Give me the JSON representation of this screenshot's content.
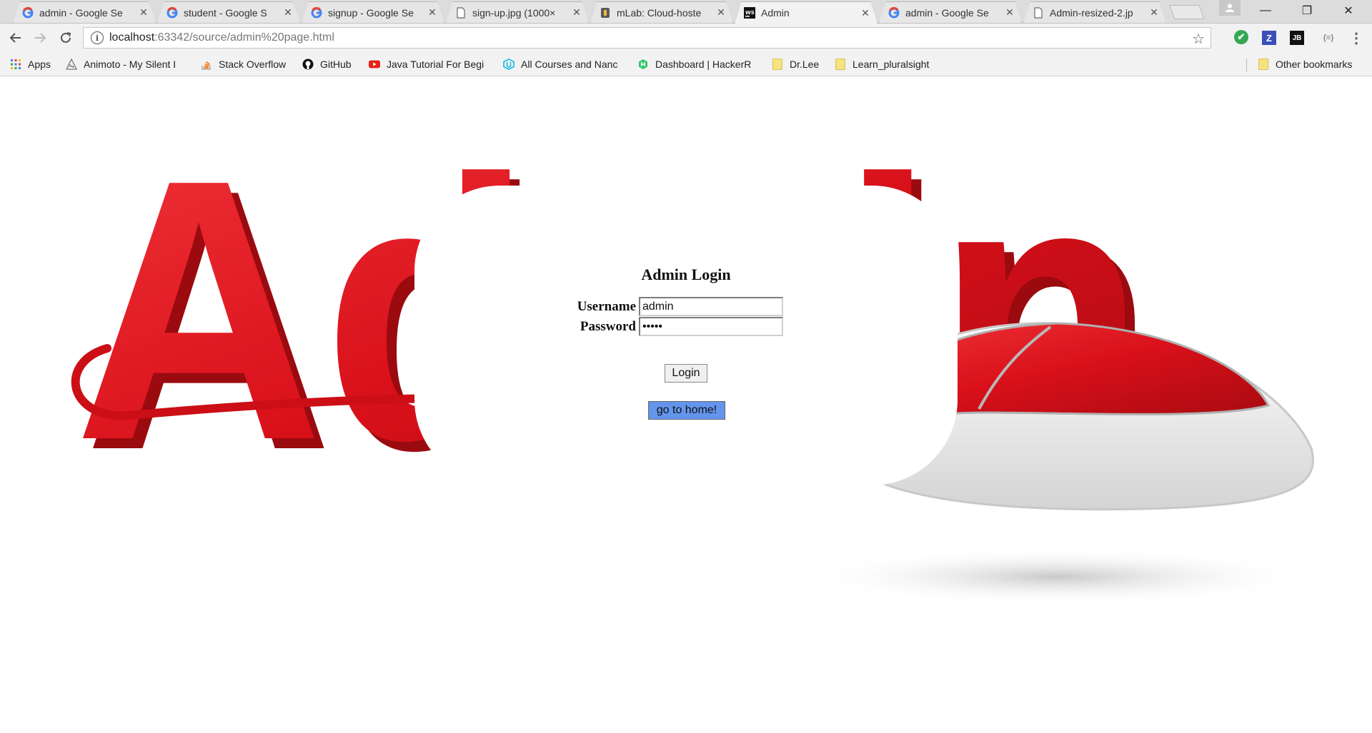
{
  "tabs": [
    {
      "title": "admin - Google Se",
      "icon": "google-icon",
      "active": false
    },
    {
      "title": "student - Google S",
      "icon": "google-icon",
      "active": false
    },
    {
      "title": "signup - Google Se",
      "icon": "google-icon",
      "active": false
    },
    {
      "title": "sign-up.jpg (1000×",
      "icon": "file-icon",
      "active": false
    },
    {
      "title": "mLab: Cloud-hoste",
      "icon": "mlab-icon",
      "active": false
    },
    {
      "title": "Admin",
      "icon": "webstorm-icon",
      "active": true
    },
    {
      "title": "admin - Google Se",
      "icon": "google-icon",
      "active": false
    },
    {
      "title": "Admin-resized-2.jp",
      "icon": "file-icon",
      "active": false
    }
  ],
  "window_controls": {
    "minimize": "—",
    "restore": "❐",
    "close": "✕"
  },
  "toolbar": {
    "url_host": "localhost",
    "url_rest": ":63342/source/admin%20page.html",
    "extensions": [
      {
        "icon": "check-icon",
        "label": "✔"
      },
      {
        "icon": "zotero-icon",
        "label": "Z"
      },
      {
        "icon": "jetbrains-icon",
        "label": "JB"
      },
      {
        "icon": "json-viewer-icon",
        "label": "{≡}"
      }
    ]
  },
  "bookmarks": [
    {
      "label": "Apps",
      "icon": "apps-grid-icon"
    },
    {
      "label": "Animoto - My Silent I",
      "icon": "animoto-icon"
    },
    {
      "label": "Stack Overflow",
      "icon": "stackoverflow-icon"
    },
    {
      "label": "GitHub",
      "icon": "github-icon"
    },
    {
      "label": "Java Tutorial For Begi",
      "icon": "youtube-icon"
    },
    {
      "label": "All Courses and Nanc",
      "icon": "udacity-icon"
    },
    {
      "label": "Dashboard | HackerR",
      "icon": "hackerrank-icon"
    },
    {
      "label": "Dr.Lee",
      "icon": "folder-icon"
    },
    {
      "label": "Learn_pluralsight",
      "icon": "folder-icon"
    }
  ],
  "other_bookmarks": "Other bookmarks",
  "background": {
    "text": "Admin",
    "color": "#e3121b"
  },
  "login": {
    "title": "Admin Login",
    "username_label": "Username",
    "username_value": "admin",
    "password_label": "Password",
    "password_value": "•••••",
    "login_button": "Login",
    "home_button": "go to home!",
    "home_button_color": "#6495ed"
  }
}
